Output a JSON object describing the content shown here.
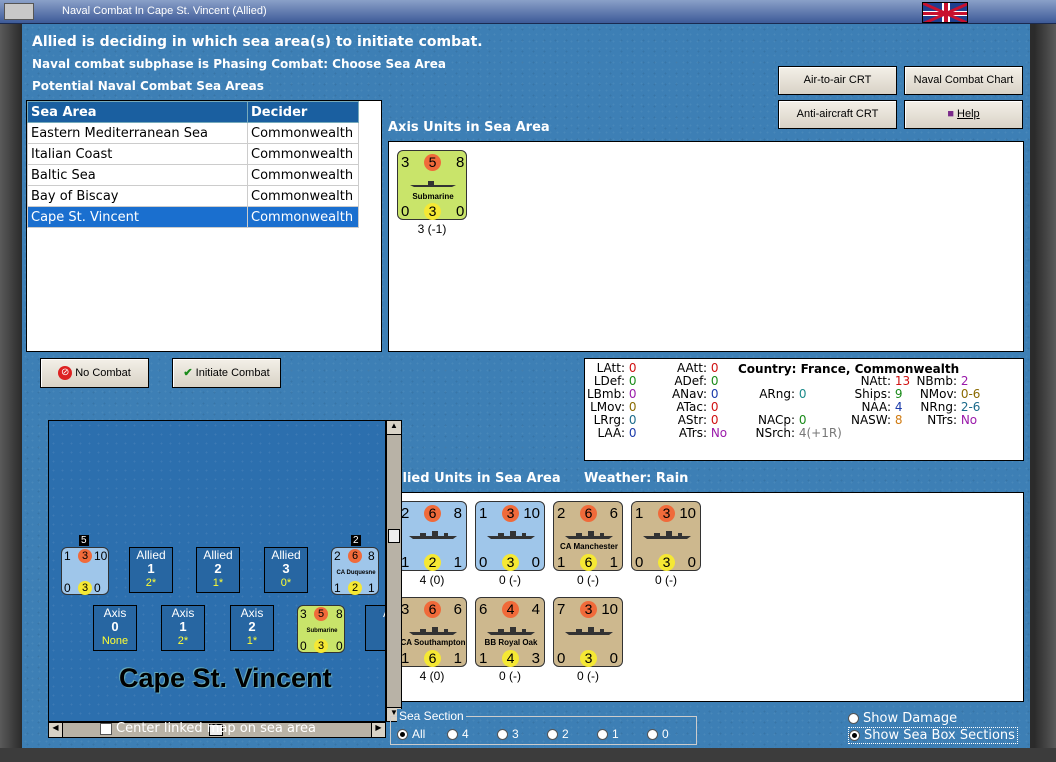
{
  "window": {
    "title": "Naval Combat In Cape St. Vincent (Allied)"
  },
  "header": {
    "line1": "Allied is deciding in which sea area(s) to initiate combat.",
    "line2": "Naval combat subphase is Phasing Combat: Choose Sea Area",
    "line3": "Potential Naval Combat Sea Areas"
  },
  "buttons": {
    "air_to_air": "Air-to-air CRT",
    "naval_chart": "Naval Combat Chart",
    "anti_aircraft": "Anti-aircraft CRT",
    "help": "Help",
    "no_combat": "No Combat",
    "initiate": "Initiate Combat"
  },
  "table": {
    "headers": [
      "Sea Area",
      "Decider"
    ],
    "rows": [
      {
        "area": "Eastern Mediterranean Sea",
        "decider": "Commonwealth"
      },
      {
        "area": "Italian Coast",
        "decider": "Commonwealth"
      },
      {
        "area": "Baltic Sea",
        "decider": "Commonwealth"
      },
      {
        "area": "Bay of Biscay",
        "decider": "Commonwealth"
      },
      {
        "area": "Cape St. Vincent",
        "decider": "Commonwealth"
      }
    ]
  },
  "axis_units": {
    "label": "Axis Units in Sea Area",
    "units": [
      {
        "tl": "3",
        "tc": "5",
        "tr": "8",
        "name": "Submarine",
        "bl": "0",
        "bc": "3",
        "br": "0",
        "caption": "3 (-1)"
      }
    ]
  },
  "stats": {
    "country_label": "Country: France, Commonwealth",
    "LAtt": "0",
    "LDef": "0",
    "LBmb": "0",
    "LMov": "0",
    "LRrg": "0",
    "LAA": "0",
    "AAtt": "0",
    "ADef": "0",
    "ANav": "0",
    "ATac": "0",
    "AStr": "0",
    "ATrs": "No",
    "ARng": "0",
    "NACp": "0",
    "NSrch": "4(+1R)",
    "NAtt": "13",
    "Ships": "9",
    "NAA": "4",
    "NASW": "8",
    "NBmb": "2",
    "NMov": "0-6",
    "NRng": "2-6",
    "NTrs": "No"
  },
  "allied_units": {
    "label": "Allied Units in Sea Area",
    "weather_label": "Weather:",
    "weather": "Rain",
    "units": [
      {
        "tl": "2",
        "tc": "6",
        "tr": "8",
        "name": "",
        "bl": "1",
        "bc": "2",
        "br": "1",
        "caption": "4 (0)",
        "color": "#9fc6ea"
      },
      {
        "tl": "1",
        "tc": "3",
        "tr": "10",
        "name": "",
        "bl": "0",
        "bc": "3",
        "br": "0",
        "caption": "0 (-)",
        "color": "#9fc6ea"
      },
      {
        "tl": "2",
        "tc": "6",
        "tr": "6",
        "name": "CA Manchester",
        "bl": "1",
        "bc": "6",
        "br": "1",
        "caption": "0 (-)",
        "color": "#cdb88e"
      },
      {
        "tl": "1",
        "tc": "3",
        "tr": "10",
        "name": "",
        "bl": "0",
        "bc": "3",
        "br": "0",
        "caption": "0 (-)",
        "color": "#cdb88e"
      },
      {
        "tl": "3",
        "tc": "6",
        "tr": "6",
        "name": "CA Southampton",
        "bl": "1",
        "bc": "6",
        "br": "1",
        "caption": "4 (0)",
        "color": "#cdb88e"
      },
      {
        "tl": "6",
        "tc": "4",
        "tr": "4",
        "name": "BB Royal Oak",
        "bl": "1",
        "bc": "4",
        "br": "3",
        "caption": "0 (-)",
        "color": "#cdb88e"
      },
      {
        "tl": "7",
        "tc": "3",
        "tr": "10",
        "name": "",
        "bl": "0",
        "bc": "3",
        "br": "0",
        "caption": "0 (-)",
        "color": "#cdb88e"
      }
    ]
  },
  "map": {
    "name": "Cape St. Vincent",
    "allied_boxes": [
      {
        "label": "Allied",
        "value": "1",
        "sub": "2*"
      },
      {
        "label": "Allied",
        "value": "2",
        "sub": "1*"
      },
      {
        "label": "Allied",
        "value": "3",
        "sub": "0*"
      }
    ],
    "axis_boxes": [
      {
        "label": "Axis",
        "value": "0",
        "sub": "None"
      },
      {
        "label": "Axis",
        "value": "1",
        "sub": "2*"
      },
      {
        "label": "Axis",
        "value": "2",
        "sub": "1*"
      }
    ],
    "stack_left": {
      "count": "5",
      "tl": "1",
      "tc": "3",
      "tr": "10",
      "bl": "0",
      "bc": "3",
      "br": "0"
    },
    "stack_right": {
      "count": "2",
      "tl": "2",
      "tc": "6",
      "tr": "8",
      "name": "CA Duquesne",
      "bl": "1",
      "bc": "2",
      "br": "1"
    },
    "sub_counter": {
      "tl": "3",
      "tc": "5",
      "tr": "8",
      "name": "Submarine",
      "bl": "0",
      "bc": "3",
      "br": "0"
    },
    "cut_label": "A"
  },
  "center_map_label": "Center linked map on sea area",
  "sea_section": {
    "label": "Sea Section",
    "options": [
      "All",
      "4",
      "3",
      "2",
      "1",
      "0"
    ]
  },
  "display": {
    "show_damage": "Show Damage",
    "show_sections": "Show Sea Box Sections"
  }
}
